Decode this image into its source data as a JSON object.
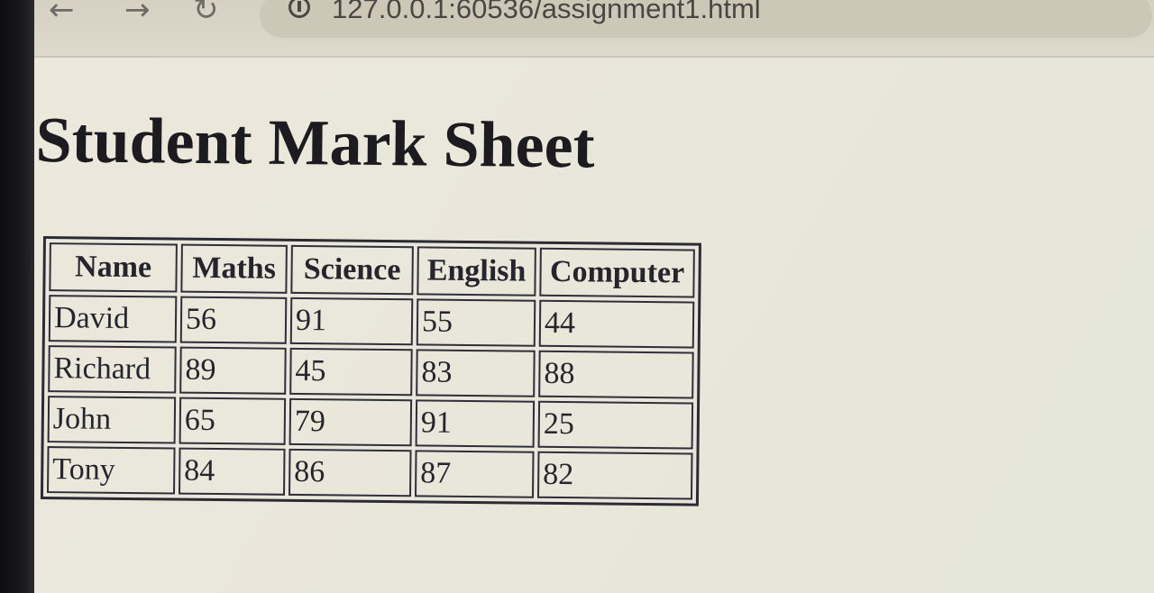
{
  "browser": {
    "back_icon": "arrow-left-icon",
    "forward_icon": "arrow-right-icon",
    "reload_icon": "reload-icon",
    "info_icon": "info-icon",
    "url": "127.0.0.1:60536/assignment1.html"
  },
  "page": {
    "title": "Student Mark Sheet"
  },
  "table": {
    "headers": [
      "Name",
      "Maths",
      "Science",
      "English",
      "Computer"
    ],
    "rows": [
      [
        "David",
        "56",
        "91",
        "55",
        "44"
      ],
      [
        "Richard",
        "89",
        "45",
        "83",
        "88"
      ],
      [
        "John",
        "65",
        "79",
        "91",
        "25"
      ],
      [
        "Tony",
        "84",
        "86",
        "87",
        "82"
      ]
    ]
  }
}
